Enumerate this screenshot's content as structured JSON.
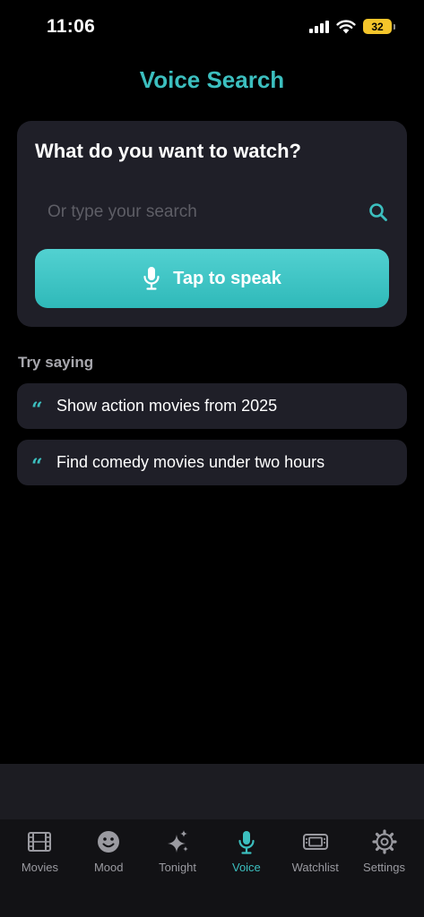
{
  "status_bar": {
    "time": "11:06",
    "battery": "32"
  },
  "header": {
    "title": "Voice Search"
  },
  "search_card": {
    "heading": "What do you want to watch?",
    "search_placeholder": "Or type your search",
    "search_value": "",
    "speak_label": "Tap to speak"
  },
  "suggestions": {
    "label": "Try saying",
    "items": [
      {
        "text": "Show action movies from 2025",
        "icon": "quote-icon"
      },
      {
        "text": "Find comedy movies under two hours",
        "icon": "quote-icon"
      }
    ]
  },
  "tab_bar": {
    "active": "voice",
    "tabs": [
      {
        "id": "movies",
        "label": "Movies",
        "icon": "film-icon"
      },
      {
        "id": "mood",
        "label": "Mood",
        "icon": "smiley-icon"
      },
      {
        "id": "tonight",
        "label": "Tonight",
        "icon": "sparkle-icon"
      },
      {
        "id": "voice",
        "label": "Voice",
        "icon": "microphone-icon"
      },
      {
        "id": "watchlist",
        "label": "Watchlist",
        "icon": "ticket-icon"
      },
      {
        "id": "settings",
        "label": "Settings",
        "icon": "gear-icon"
      }
    ]
  },
  "colors": {
    "accent": "#3cbfbf",
    "background": "#000000",
    "card": "#1f1f28",
    "inactive": "#9a9aa0",
    "battery": "#f4c52b"
  }
}
